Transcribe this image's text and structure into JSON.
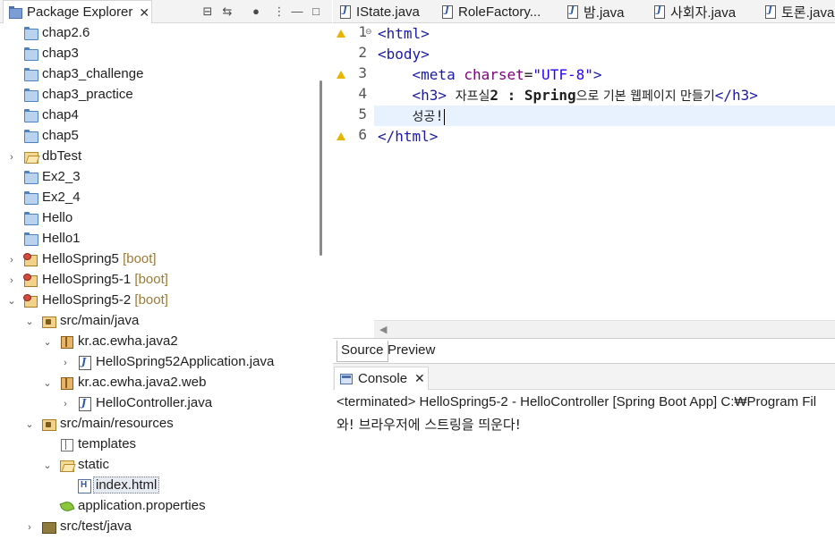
{
  "explorer": {
    "title": "Package Explorer",
    "close": "✕",
    "rows": [
      {
        "label": "chap2.6",
        "deco": ""
      },
      {
        "label": "chap3",
        "deco": ""
      },
      {
        "label": "chap3_challenge",
        "deco": ""
      },
      {
        "label": "chap3_practice",
        "deco": ""
      },
      {
        "label": "chap4",
        "deco": ""
      },
      {
        "label": "chap5",
        "deco": ""
      },
      {
        "label": "dbTest",
        "deco": ""
      },
      {
        "label": "Ex2_3",
        "deco": ""
      },
      {
        "label": "Ex2_4",
        "deco": ""
      },
      {
        "label": "Hello",
        "deco": ""
      },
      {
        "label": "Hello1",
        "deco": ""
      },
      {
        "label": "HelloSpring5",
        "deco": "[boot]"
      },
      {
        "label": "HelloSpring5-1",
        "deco": "[boot]"
      },
      {
        "label": "HelloSpring5-2",
        "deco": "[boot]"
      },
      {
        "label": "src/main/java",
        "deco": ""
      },
      {
        "label": "kr.ac.ewha.java2",
        "deco": ""
      },
      {
        "label": "HelloSpring52Application.java",
        "deco": ""
      },
      {
        "label": "kr.ac.ewha.java2.web",
        "deco": ""
      },
      {
        "label": "HelloController.java",
        "deco": ""
      },
      {
        "label": "src/main/resources",
        "deco": ""
      },
      {
        "label": "templates",
        "deco": ""
      },
      {
        "label": "static",
        "deco": ""
      },
      {
        "label": "index.html",
        "deco": ""
      },
      {
        "label": "application.properties",
        "deco": ""
      },
      {
        "label": "src/test/java",
        "deco": ""
      }
    ]
  },
  "editor": {
    "tabs": [
      "IState.java",
      "RoleFactory...",
      "밤.java",
      "사회자.java",
      "토론.java"
    ],
    "line_numbers": [
      "1",
      "2",
      "3",
      "4",
      "5",
      "6"
    ],
    "code": {
      "l1": "<html>",
      "l2": "<body>",
      "l3_tag_open": "<meta",
      "l3_attr": "charset",
      "l3_eq": "=",
      "l3_val": "\"UTF-8\"",
      "l3_tag_close": ">",
      "l4_open": "<h3>",
      "l4_text_a": "자프실",
      "l4_text_b": "2 : Spring",
      "l4_text_c": "으로 기본 웹페이지 만들기",
      "l4_close": "</h3>",
      "l5_text": "성공",
      "l5_bang": "!",
      "l6": "</html>"
    },
    "subtabs": {
      "source": "Source",
      "preview": "Preview"
    }
  },
  "console": {
    "title": "Console",
    "close": "✕",
    "terminated": "<terminated> HelloSpring5-2 - HelloController [Spring Boot App] C:₩Program Fil",
    "output": "와! 브라우저에 스트링을 띄운다!"
  }
}
